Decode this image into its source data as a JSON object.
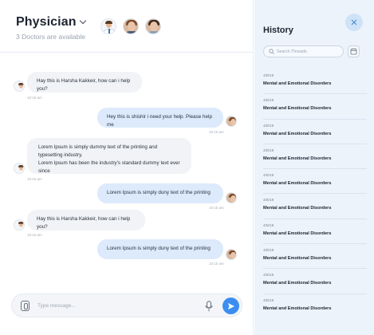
{
  "header": {
    "title": "Physician",
    "subtitle": "3 Doctors are available",
    "doctors": [
      "doctor-avatar",
      "doctor-avatar",
      "doctor-avatar"
    ]
  },
  "messages": [
    {
      "from": "doctor",
      "text": "Hay this is Harsha Kakkeir, how can i help you?",
      "time": "10:15 am"
    },
    {
      "from": "user",
      "text": "Hey this is shishir i need your help. Please help me",
      "time": "10:15 am"
    },
    {
      "from": "doctor",
      "text": "Lorem Ipsum is simply dummy text of the printing and typesetting industry.",
      "text2": "Lorem Ipsum has been the industry's standard dummy text ever since",
      "time": "10:15 am"
    },
    {
      "from": "user",
      "text": "Lorem Ipsum is simply duny text of the printing",
      "time": "10:15 am"
    },
    {
      "from": "doctor",
      "text": "Hay this is Harsha Kakkeir, how can i help you?",
      "time": "10:15 am"
    },
    {
      "from": "user",
      "text": "Lorem Ipsum is simply duny text of the printing",
      "time": "10:15 am"
    }
  ],
  "composer": {
    "placeholder": "Type message..."
  },
  "history": {
    "title": "History",
    "search_placeholder": "Search Threads",
    "items": [
      {
        "date": "4/8/19",
        "topic": "Mental and Emotional Disorders"
      },
      {
        "date": "4/8/19",
        "topic": "Mental and Emotional Disorders"
      },
      {
        "date": "4/8/19",
        "topic": "Mental and Emotional Disorders"
      },
      {
        "date": "4/8/19",
        "topic": "Mental and Emotional Disorders"
      },
      {
        "date": "4/8/19",
        "topic": "Mental and Emotional Disorders"
      },
      {
        "date": "4/8/19",
        "topic": "Mental and Emotional Disorders"
      },
      {
        "date": "4/8/19",
        "topic": "Mental and Emotional Disorders"
      },
      {
        "date": "4/8/19",
        "topic": "Mental and Emotional Disorders"
      },
      {
        "date": "4/8/19",
        "topic": "Mental and Emotional Disorders"
      },
      {
        "date": "4/8/19",
        "topic": "Mental and Emotional Disorders"
      }
    ]
  },
  "colors": {
    "accent": "#3b8ef0",
    "incoming_bubble": "#f1f3f6",
    "outgoing_bubble": "#ddeafc",
    "history_bg": "#ecf3fb"
  },
  "icons": {
    "dropdown": "chevron-down-icon",
    "close": "close-icon",
    "search": "search-icon",
    "calendar": "calendar-icon",
    "attach": "attachment-icon",
    "mic": "microphone-icon",
    "send": "send-icon"
  }
}
